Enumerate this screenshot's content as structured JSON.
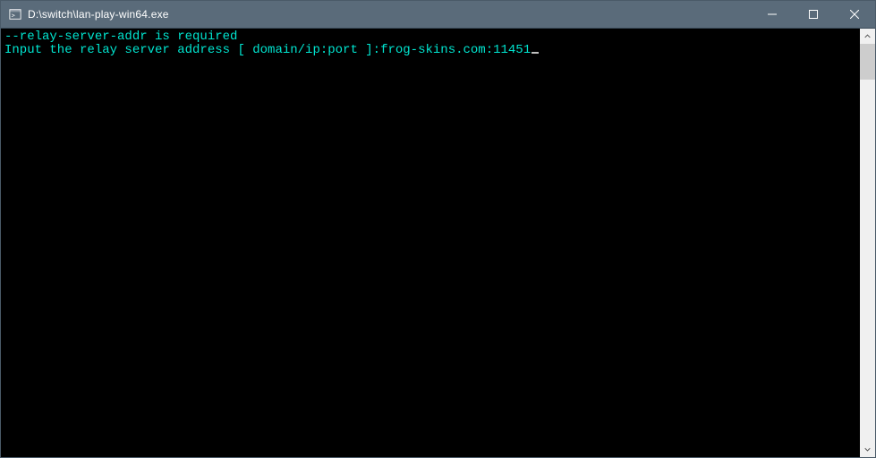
{
  "window": {
    "title": "D:\\switch\\lan-play-win64.exe"
  },
  "console": {
    "line1": "--relay-server-addr is required",
    "line2_prompt": "Input the relay server address [ domain/ip:port ]:",
    "line2_input": "frog-skins.com:11451"
  }
}
